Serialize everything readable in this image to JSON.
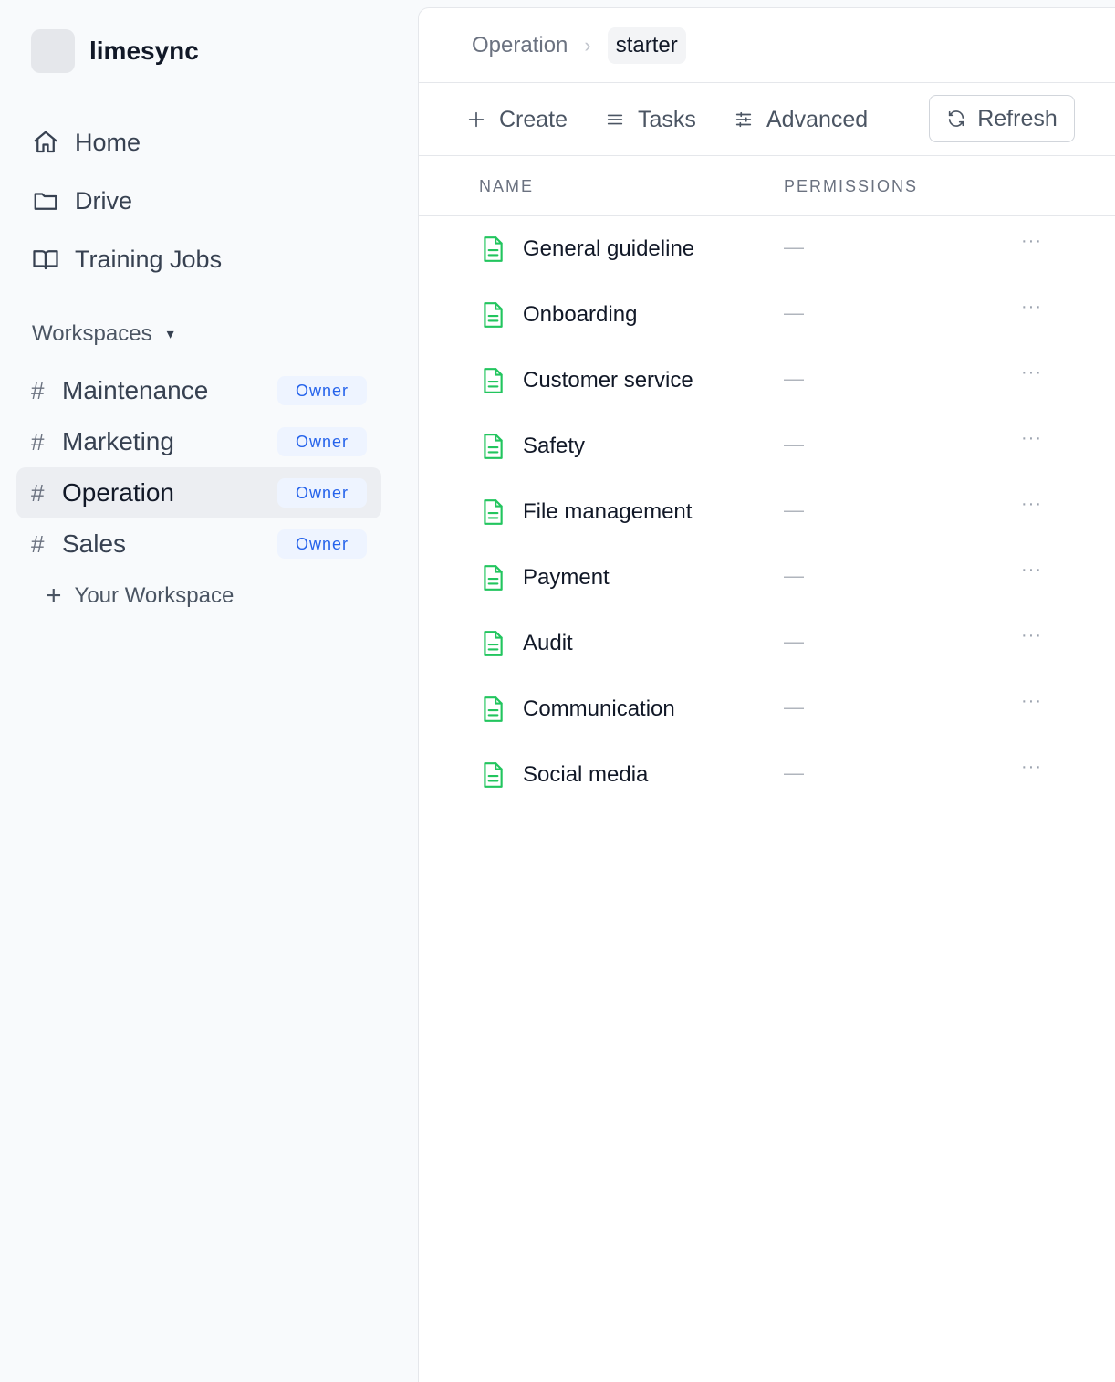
{
  "brand": {
    "name": "limesync"
  },
  "nav": [
    {
      "label": "Home",
      "icon": "home-icon"
    },
    {
      "label": "Drive",
      "icon": "folder-icon"
    },
    {
      "label": "Training Jobs",
      "icon": "book-icon"
    }
  ],
  "workspaces": {
    "title": "Workspaces",
    "caret": "▾",
    "items": [
      {
        "hash": "#",
        "name": "Maintenance",
        "role": "Owner",
        "active": false
      },
      {
        "hash": "#",
        "name": "Marketing",
        "role": "Owner",
        "active": false
      },
      {
        "hash": "#",
        "name": "Operation",
        "role": "Owner",
        "active": true
      },
      {
        "hash": "#",
        "name": "Sales",
        "role": "Owner",
        "active": false
      }
    ],
    "add_label": "Your Workspace"
  },
  "breadcrumb": {
    "parent": "Operation",
    "separator": "›",
    "current": "starter"
  },
  "toolbar": {
    "create": "Create",
    "tasks": "Tasks",
    "advanced": "Advanced",
    "refresh": "Refresh"
  },
  "table": {
    "columns": [
      "NAME",
      "PERMISSIONS"
    ],
    "rows": [
      {
        "name": "General guideline",
        "permissions": "—",
        "more": "···"
      },
      {
        "name": "Onboarding",
        "permissions": "—",
        "more": "···"
      },
      {
        "name": "Customer service",
        "permissions": "—",
        "more": "···"
      },
      {
        "name": "Safety",
        "permissions": "—",
        "more": "···"
      },
      {
        "name": "File management",
        "permissions": "—",
        "more": "···"
      },
      {
        "name": "Payment",
        "permissions": "—",
        "more": "···"
      },
      {
        "name": "Audit",
        "permissions": "—",
        "more": "···"
      },
      {
        "name": "Communication",
        "permissions": "—",
        "more": "···"
      },
      {
        "name": "Social media",
        "permissions": "—",
        "more": "···"
      }
    ]
  },
  "colors": {
    "file_icon": "#22c55e",
    "badge_text": "#2563eb",
    "badge_bg": "#eef4ff",
    "active_bg": "#eceef2"
  }
}
